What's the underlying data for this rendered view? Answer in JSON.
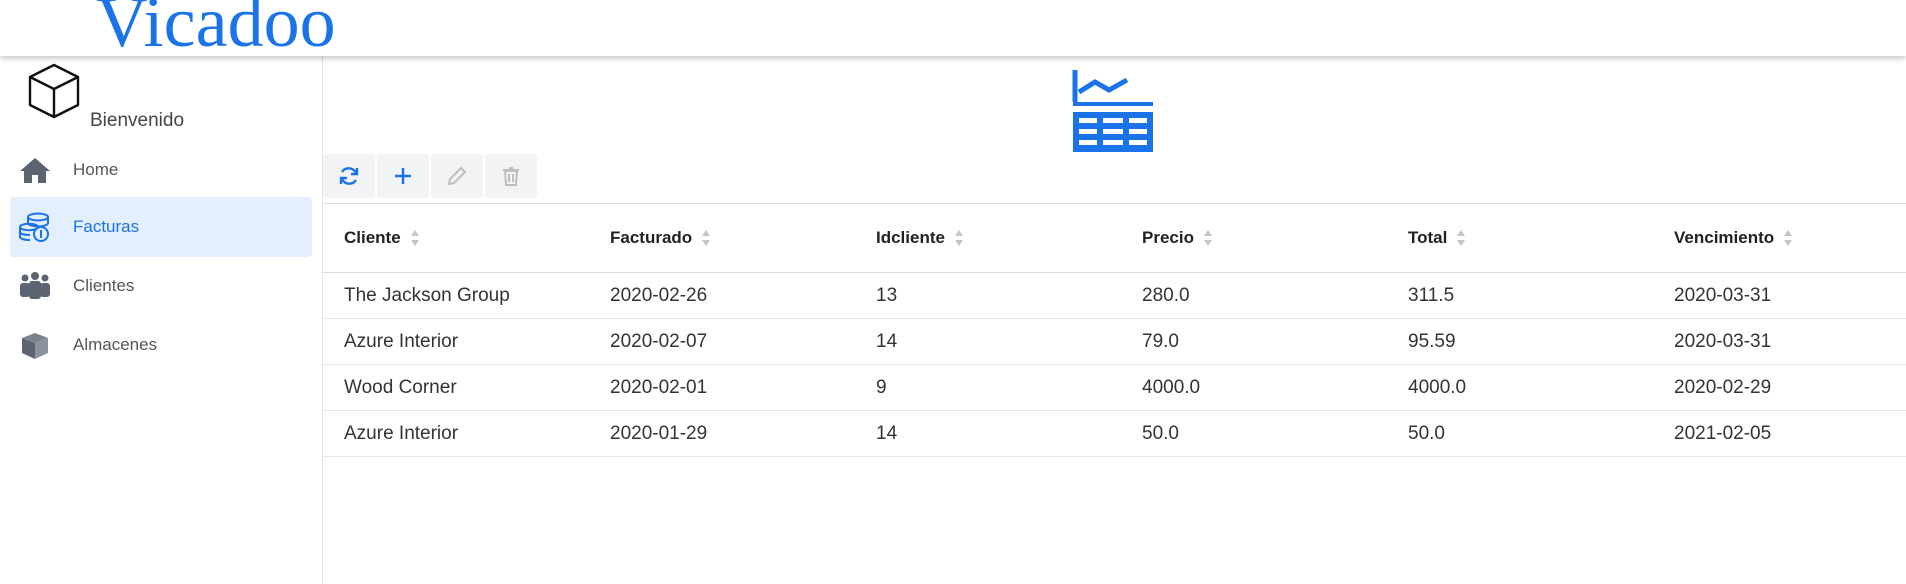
{
  "header": {
    "brand": "Vicadoo"
  },
  "sidebar": {
    "welcome": "Bienvenido",
    "items": [
      {
        "label": "Home",
        "icon": "home-icon",
        "active": false
      },
      {
        "label": "Facturas",
        "icon": "coins-icon",
        "active": true
      },
      {
        "label": "Clientes",
        "icon": "users-icon",
        "active": false
      },
      {
        "label": "Almacenes",
        "icon": "box-icon",
        "active": false
      }
    ]
  },
  "toolbar": {
    "buttons": [
      {
        "name": "refresh",
        "icon": "refresh-icon",
        "enabled": true
      },
      {
        "name": "add",
        "icon": "plus-icon",
        "enabled": true
      },
      {
        "name": "edit",
        "icon": "pencil-icon",
        "enabled": false
      },
      {
        "name": "delete",
        "icon": "trash-icon",
        "enabled": false
      }
    ]
  },
  "colors": {
    "accent": "#1a73e8",
    "active_bg": "#e3effd",
    "toolbar_bg": "#f2f3f5",
    "disabled": "#bdbdbd"
  },
  "table": {
    "columns": [
      "Cliente",
      "Facturado",
      "Idcliente",
      "Precio",
      "Total",
      "Vencimiento"
    ],
    "rows": [
      [
        "The Jackson Group",
        "2020-02-26",
        "13",
        "280.0",
        "311.5",
        "2020-03-31"
      ],
      [
        "Azure Interior",
        "2020-02-07",
        "14",
        "79.0",
        "95.59",
        "2020-03-31"
      ],
      [
        "Wood Corner",
        "2020-02-01",
        "9",
        "4000.0",
        "4000.0",
        "2020-02-29"
      ],
      [
        "Azure Interior",
        "2020-01-29",
        "14",
        "50.0",
        "50.0",
        "2021-02-05"
      ]
    ]
  }
}
